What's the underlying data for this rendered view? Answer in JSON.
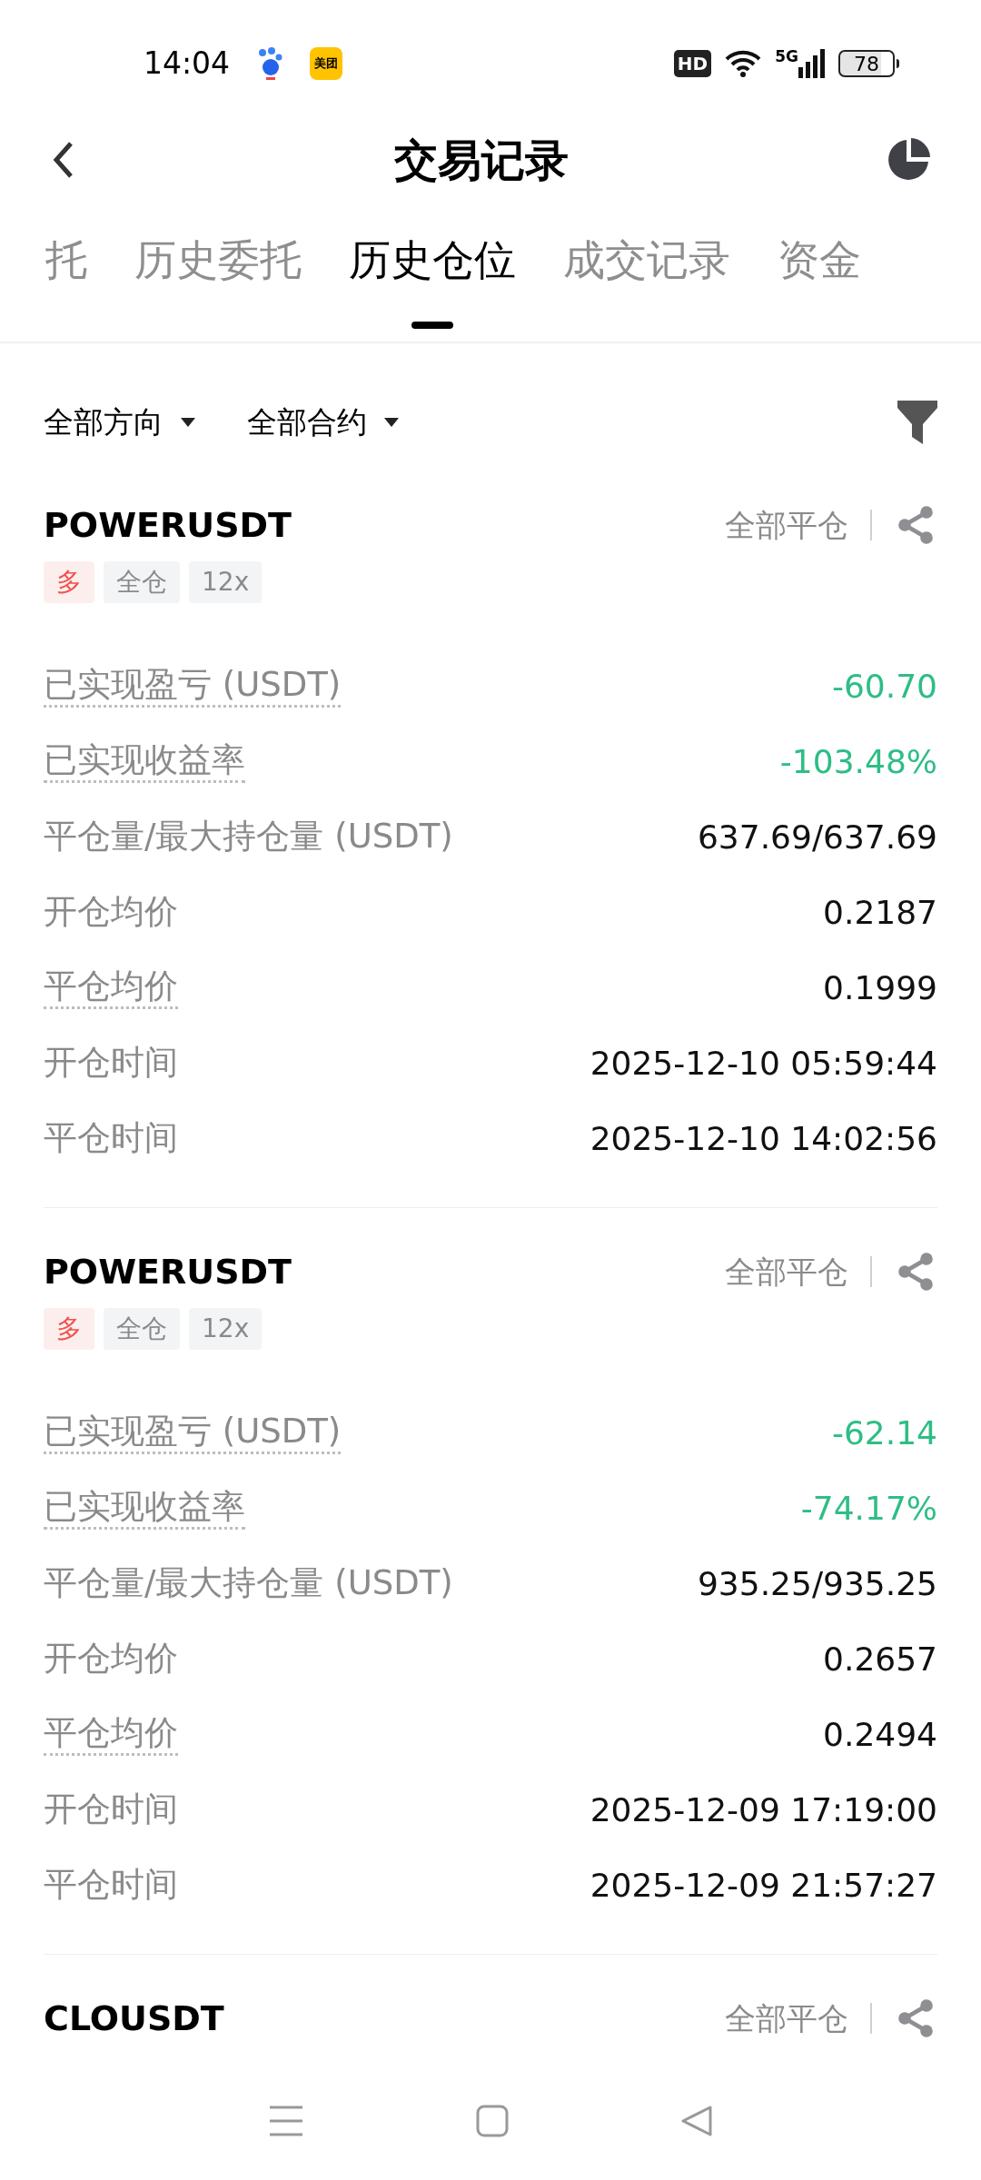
{
  "status_bar": {
    "time": "14:04",
    "app_badge": "美团",
    "hd": "HD",
    "network": "5G",
    "battery": "78"
  },
  "header": {
    "title": "交易记录"
  },
  "tabs": [
    {
      "label": "托",
      "selected": false
    },
    {
      "label": "历史委托",
      "selected": false
    },
    {
      "label": "历史仓位",
      "selected": true
    },
    {
      "label": "成交记录",
      "selected": false
    },
    {
      "label": "资金",
      "selected": false
    }
  ],
  "filters": [
    {
      "label": "全部方向"
    },
    {
      "label": "全部合约"
    }
  ],
  "positions": [
    {
      "symbol": "POWERUSDT",
      "action": "全部平仓",
      "tags": [
        {
          "label": "多",
          "kind": "long"
        },
        {
          "label": "全仓",
          "kind": "plain"
        },
        {
          "label": "12x",
          "kind": "plain"
        }
      ],
      "rows": [
        {
          "label": "已实现盈亏 (USDT)",
          "dotted": true,
          "value": "-60.70",
          "loss": true
        },
        {
          "label": "已实现收益率",
          "dotted": true,
          "value": "-103.48%",
          "loss": true
        },
        {
          "label": "平仓量/最大持仓量 (USDT)",
          "dotted": false,
          "value": "637.69/637.69",
          "loss": false
        },
        {
          "label": "开仓均价",
          "dotted": false,
          "value": "0.2187",
          "loss": false
        },
        {
          "label": "平仓均价",
          "dotted": true,
          "value": "0.1999",
          "loss": false
        },
        {
          "label": "开仓时间",
          "dotted": false,
          "value": "2025-12-10 05:59:44",
          "loss": false
        },
        {
          "label": "平仓时间",
          "dotted": false,
          "value": "2025-12-10 14:02:56",
          "loss": false
        }
      ]
    },
    {
      "symbol": "POWERUSDT",
      "action": "全部平仓",
      "tags": [
        {
          "label": "多",
          "kind": "long"
        },
        {
          "label": "全仓",
          "kind": "plain"
        },
        {
          "label": "12x",
          "kind": "plain"
        }
      ],
      "rows": [
        {
          "label": "已实现盈亏 (USDT)",
          "dotted": true,
          "value": "-62.14",
          "loss": true
        },
        {
          "label": "已实现收益率",
          "dotted": true,
          "value": "-74.17%",
          "loss": true
        },
        {
          "label": "平仓量/最大持仓量 (USDT)",
          "dotted": false,
          "value": "935.25/935.25",
          "loss": false
        },
        {
          "label": "开仓均价",
          "dotted": false,
          "value": "0.2657",
          "loss": false
        },
        {
          "label": "平仓均价",
          "dotted": true,
          "value": "0.2494",
          "loss": false
        },
        {
          "label": "开仓时间",
          "dotted": false,
          "value": "2025-12-09 17:19:00",
          "loss": false
        },
        {
          "label": "平仓时间",
          "dotted": false,
          "value": "2025-12-09 21:57:27",
          "loss": false
        }
      ]
    },
    {
      "symbol": "CLOUSDT",
      "action": "全部平仓"
    }
  ]
}
